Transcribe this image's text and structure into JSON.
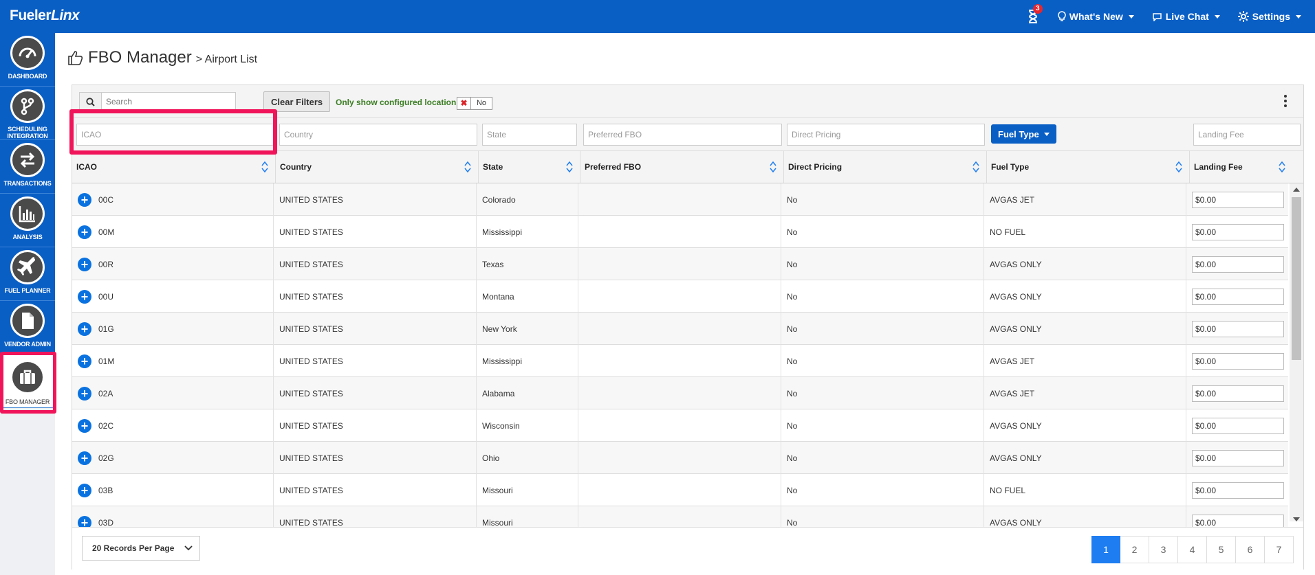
{
  "brand": {
    "main": "Fueler",
    "accent": "Linx"
  },
  "topnav": {
    "notifications": "3",
    "whats_new": "What's New",
    "live_chat": "Live Chat",
    "settings": "Settings"
  },
  "sidebar": {
    "items": [
      {
        "label": "DASHBOARD",
        "icon": "gauge-icon"
      },
      {
        "label": "SCHEDULING INTEGRATION",
        "icon": "fork-icon"
      },
      {
        "label": "TRANSACTIONS",
        "icon": "exchange-arrows-icon"
      },
      {
        "label": "ANALYSIS",
        "icon": "bar-chart-icon"
      },
      {
        "label": "FUEL PLANNER",
        "icon": "plane-icon"
      },
      {
        "label": "VENDOR ADMIN",
        "icon": "document-icon"
      },
      {
        "label": "FBO MANAGER",
        "icon": "briefcase-icon"
      }
    ]
  },
  "page": {
    "title": "FBO Manager",
    "breadcrumb": "> Airport List"
  },
  "toolbar": {
    "search_placeholder": "Search",
    "clear_filters": "Clear Filters",
    "only_show_label": "Only show configured locations",
    "toggle_value": "No"
  },
  "filters": {
    "icao": "ICAO",
    "country": "Country",
    "state": "State",
    "preferred_fbo": "Preferred FBO",
    "direct_pricing": "Direct Pricing",
    "fuel_type": "Fuel Type",
    "landing_fee": "Landing Fee"
  },
  "columns": [
    "ICAO",
    "Country",
    "State",
    "Preferred FBO",
    "Direct Pricing",
    "Fuel Type",
    "Landing Fee"
  ],
  "rows": [
    {
      "icao": "00C",
      "country": "UNITED STATES",
      "state": "Colorado",
      "fbo": "",
      "direct": "No",
      "fuel": "AVGAS JET",
      "fee": "$0.00"
    },
    {
      "icao": "00M",
      "country": "UNITED STATES",
      "state": "Mississippi",
      "fbo": "",
      "direct": "No",
      "fuel": "NO FUEL",
      "fee": "$0.00"
    },
    {
      "icao": "00R",
      "country": "UNITED STATES",
      "state": "Texas",
      "fbo": "",
      "direct": "No",
      "fuel": "AVGAS ONLY",
      "fee": "$0.00"
    },
    {
      "icao": "00U",
      "country": "UNITED STATES",
      "state": "Montana",
      "fbo": "",
      "direct": "No",
      "fuel": "AVGAS ONLY",
      "fee": "$0.00"
    },
    {
      "icao": "01G",
      "country": "UNITED STATES",
      "state": "New York",
      "fbo": "",
      "direct": "No",
      "fuel": "AVGAS ONLY",
      "fee": "$0.00"
    },
    {
      "icao": "01M",
      "country": "UNITED STATES",
      "state": "Mississippi",
      "fbo": "",
      "direct": "No",
      "fuel": "AVGAS JET",
      "fee": "$0.00"
    },
    {
      "icao": "02A",
      "country": "UNITED STATES",
      "state": "Alabama",
      "fbo": "",
      "direct": "No",
      "fuel": "AVGAS JET",
      "fee": "$0.00"
    },
    {
      "icao": "02C",
      "country": "UNITED STATES",
      "state": "Wisconsin",
      "fbo": "",
      "direct": "No",
      "fuel": "AVGAS ONLY",
      "fee": "$0.00"
    },
    {
      "icao": "02G",
      "country": "UNITED STATES",
      "state": "Ohio",
      "fbo": "",
      "direct": "No",
      "fuel": "AVGAS ONLY",
      "fee": "$0.00"
    },
    {
      "icao": "03B",
      "country": "UNITED STATES",
      "state": "Missouri",
      "fbo": "",
      "direct": "No",
      "fuel": "NO FUEL",
      "fee": "$0.00"
    },
    {
      "icao": "03D",
      "country": "UNITED STATES",
      "state": "Missouri",
      "fbo": "",
      "direct": "No",
      "fuel": "AVGAS ONLY",
      "fee": "$0.00"
    }
  ],
  "footer": {
    "per_page": "20 Records Per Page",
    "pages": [
      "1",
      "2",
      "3",
      "4",
      "5",
      "6",
      "7"
    ],
    "active_page": "1"
  },
  "colors": {
    "primary": "#0a5fc5",
    "highlight": "#f0155b",
    "accent_green": "#3b7d23"
  }
}
